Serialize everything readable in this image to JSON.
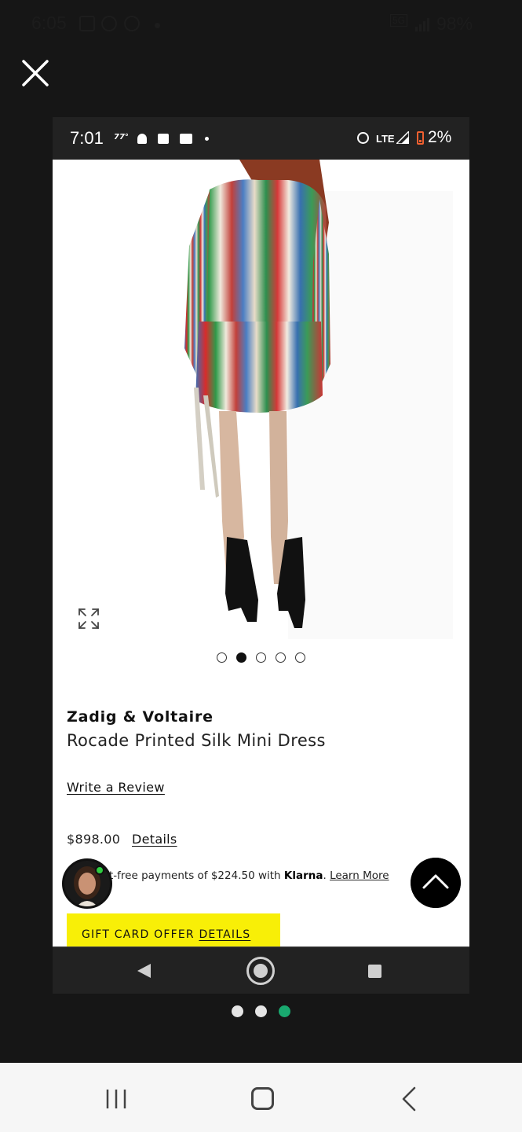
{
  "outer_status": {
    "time": "6:05",
    "network": "5G",
    "battery": "98%"
  },
  "viewer": {
    "close_icon": "close-icon",
    "page_indicator": {
      "count": 3,
      "active_index": 2
    }
  },
  "inner_status": {
    "time": "7:01",
    "temperature": "77°",
    "network": "LTE",
    "battery": "2%"
  },
  "product": {
    "image_alt": "Model wearing a multicolor striped silk mini dress and black boots",
    "carousel": {
      "count": 5,
      "active_index": 1
    },
    "brand": "Zadig & Voltaire",
    "name": "Rocade Printed Silk Mini Dress",
    "review_link": "Write a Review",
    "price": "$898.00",
    "details_link": "Details",
    "klarna": {
      "prefix": "t-free payments of $224.50 with ",
      "brand": "Klarna",
      "separator": ". ",
      "learn_more": "Learn More"
    },
    "gift_banner": {
      "text": "GIFT CARD OFFER ",
      "link": "DETAILS",
      "color": "#f8ef07"
    }
  },
  "colors": {
    "background": "#161616",
    "online_indicator": "#2ecc40",
    "active_page_dot": "#19a96f"
  }
}
